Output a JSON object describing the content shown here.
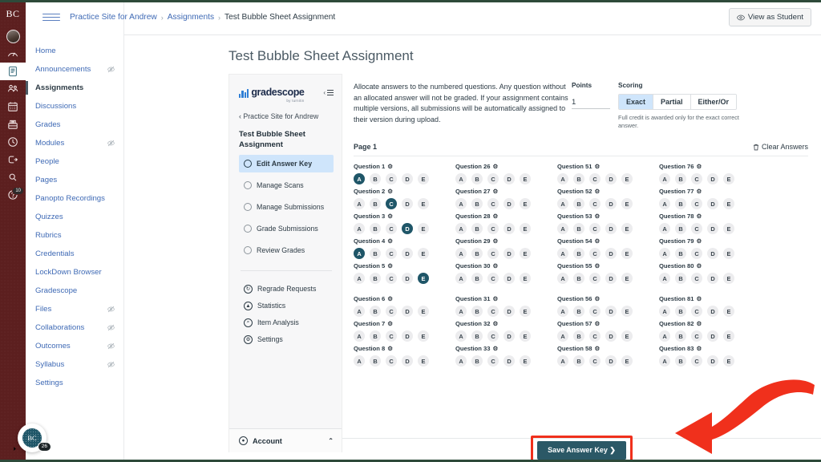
{
  "global_nav": {
    "logo": "BC",
    "items": [
      {
        "name": "account-avatar",
        "icon": "avatar-icon",
        "label": "Account"
      },
      {
        "name": "dashboard",
        "icon": "dashboard-icon",
        "label": "Dashboard"
      },
      {
        "name": "courses",
        "icon": "courses-book-icon",
        "label": "Courses",
        "active": true
      },
      {
        "name": "groups",
        "icon": "groups-icon",
        "label": "Groups"
      },
      {
        "name": "calendar",
        "icon": "calendar-icon",
        "label": "Calendar"
      },
      {
        "name": "inbox",
        "icon": "inbox-icon",
        "label": "Inbox"
      },
      {
        "name": "history",
        "icon": "clock-icon",
        "label": "History"
      },
      {
        "name": "commons",
        "icon": "logout-arrow-icon",
        "label": "Commons"
      },
      {
        "name": "studio",
        "icon": "search-icon",
        "label": "Studio"
      },
      {
        "name": "help",
        "icon": "help-icon",
        "label": "Help",
        "badge": "10"
      }
    ],
    "collapse_label": "Minimize Global Navigation"
  },
  "course_nav": {
    "items": [
      {
        "label": "Home",
        "hidden": false
      },
      {
        "label": "Announcements",
        "hidden": true
      },
      {
        "label": "Assignments",
        "hidden": false,
        "active": true
      },
      {
        "label": "Discussions",
        "hidden": false
      },
      {
        "label": "Grades",
        "hidden": false
      },
      {
        "label": "Modules",
        "hidden": true
      },
      {
        "label": "People",
        "hidden": false
      },
      {
        "label": "Pages",
        "hidden": false
      },
      {
        "label": "Panopto Recordings",
        "hidden": false
      },
      {
        "label": "Quizzes",
        "hidden": false
      },
      {
        "label": "Rubrics",
        "hidden": false
      },
      {
        "label": "Credentials",
        "hidden": false
      },
      {
        "label": "LockDown Browser",
        "hidden": false
      },
      {
        "label": "Gradescope",
        "hidden": false
      },
      {
        "label": "Files",
        "hidden": true
      },
      {
        "label": "Collaborations",
        "hidden": true
      },
      {
        "label": "Outcomes",
        "hidden": true
      },
      {
        "label": "Syllabus",
        "hidden": true
      },
      {
        "label": "Settings",
        "hidden": false
      }
    ]
  },
  "topbar": {
    "breadcrumbs": [
      {
        "label": "Practice Site for Andrew",
        "link": true
      },
      {
        "label": "Assignments",
        "link": true
      },
      {
        "label": "Test Bubble Sheet Assignment",
        "link": false
      }
    ],
    "separator": "›",
    "view_as_student": "View as Student",
    "view_as_student_icon": "eye-icon"
  },
  "page_title": "Test Bubble Sheet Assignment",
  "gradescope_panel": {
    "logo_text": "gradescope",
    "logo_sub": "by turnitin",
    "collapse_icon": "collapse-menu-icon",
    "back_link": "‹ Practice Site for Andrew",
    "assignment_title": "Test Bubble Sheet Assignment",
    "steps": [
      {
        "label": "Edit Answer Key",
        "active": true
      },
      {
        "label": "Manage Scans",
        "active": false
      },
      {
        "label": "Manage Submissions",
        "active": false
      },
      {
        "label": "Grade Submissions",
        "active": false
      },
      {
        "label": "Review Grades",
        "active": false
      }
    ],
    "tools": [
      {
        "label": "Regrade Requests",
        "icon": "regrade-icon",
        "glyph": "↻"
      },
      {
        "label": "Statistics",
        "icon": "statistics-icon",
        "glyph": "▲"
      },
      {
        "label": "Item Analysis",
        "icon": "item-analysis-icon",
        "glyph": "⌕"
      },
      {
        "label": "Settings",
        "icon": "gear-icon",
        "glyph": "⚙"
      }
    ],
    "account_label": "Account",
    "account_icon": "user-circle-icon",
    "account_caret": "⌃"
  },
  "answer_key": {
    "instructions": "Allocate answers to the numbered questions. Any question without an allocated answer will not be graded. If your assignment contains multiple versions, all submissions will be automatically assigned to their version during upload.",
    "points_label": "Points",
    "points_value": "1",
    "scoring_label": "Scoring",
    "scoring_options": [
      {
        "label": "Exact",
        "selected": true
      },
      {
        "label": "Partial",
        "selected": false
      },
      {
        "label": "Either/Or",
        "selected": false
      }
    ],
    "scoring_note": "Full credit is awarded only for the exact correct answer.",
    "page_label": "Page 1",
    "clear_answers": "Clear Answers",
    "clear_answers_icon": "trash-icon",
    "question_prefix": "Question",
    "gear_icon": "gear-icon",
    "choices": [
      "A",
      "B",
      "C",
      "D",
      "E"
    ],
    "columns": [
      {
        "questions": [
          {
            "number": 1,
            "selected": "A"
          },
          {
            "number": 2,
            "selected": "C"
          },
          {
            "number": 3,
            "selected": "D"
          },
          {
            "number": 4,
            "selected": "A"
          },
          {
            "number": 5,
            "selected": "E"
          },
          {
            "number": 6,
            "selected": null
          },
          {
            "number": 7,
            "selected": null
          },
          {
            "number": 8,
            "selected": null
          }
        ]
      },
      {
        "questions": [
          {
            "number": 26,
            "selected": null
          },
          {
            "number": 27,
            "selected": null
          },
          {
            "number": 28,
            "selected": null
          },
          {
            "number": 29,
            "selected": null
          },
          {
            "number": 30,
            "selected": null
          },
          {
            "number": 31,
            "selected": null
          },
          {
            "number": 32,
            "selected": null
          },
          {
            "number": 33,
            "selected": null
          }
        ]
      },
      {
        "questions": [
          {
            "number": 51,
            "selected": null
          },
          {
            "number": 52,
            "selected": null
          },
          {
            "number": 53,
            "selected": null
          },
          {
            "number": 54,
            "selected": null
          },
          {
            "number": 55,
            "selected": null
          },
          {
            "number": 56,
            "selected": null
          },
          {
            "number": 57,
            "selected": null
          },
          {
            "number": 58,
            "selected": null
          }
        ]
      },
      {
        "questions": [
          {
            "number": 76,
            "selected": null
          },
          {
            "number": 77,
            "selected": null
          },
          {
            "number": 78,
            "selected": null
          },
          {
            "number": 79,
            "selected": null
          },
          {
            "number": 80,
            "selected": null
          },
          {
            "number": 81,
            "selected": null
          },
          {
            "number": 82,
            "selected": null
          },
          {
            "number": 83,
            "selected": null
          }
        ]
      }
    ],
    "save_button": "Save Answer Key ❯"
  },
  "chat_widget": {
    "label": "BC",
    "badge": "26"
  },
  "colors": {
    "brand_maroon": "#5c1f1f",
    "link_blue": "#3f6ab5",
    "selected_bubble": "#1f5668",
    "active_step_bg": "#cfe5fb",
    "save_button_bg": "#2b5866",
    "annotation_red": "#f0301c"
  }
}
